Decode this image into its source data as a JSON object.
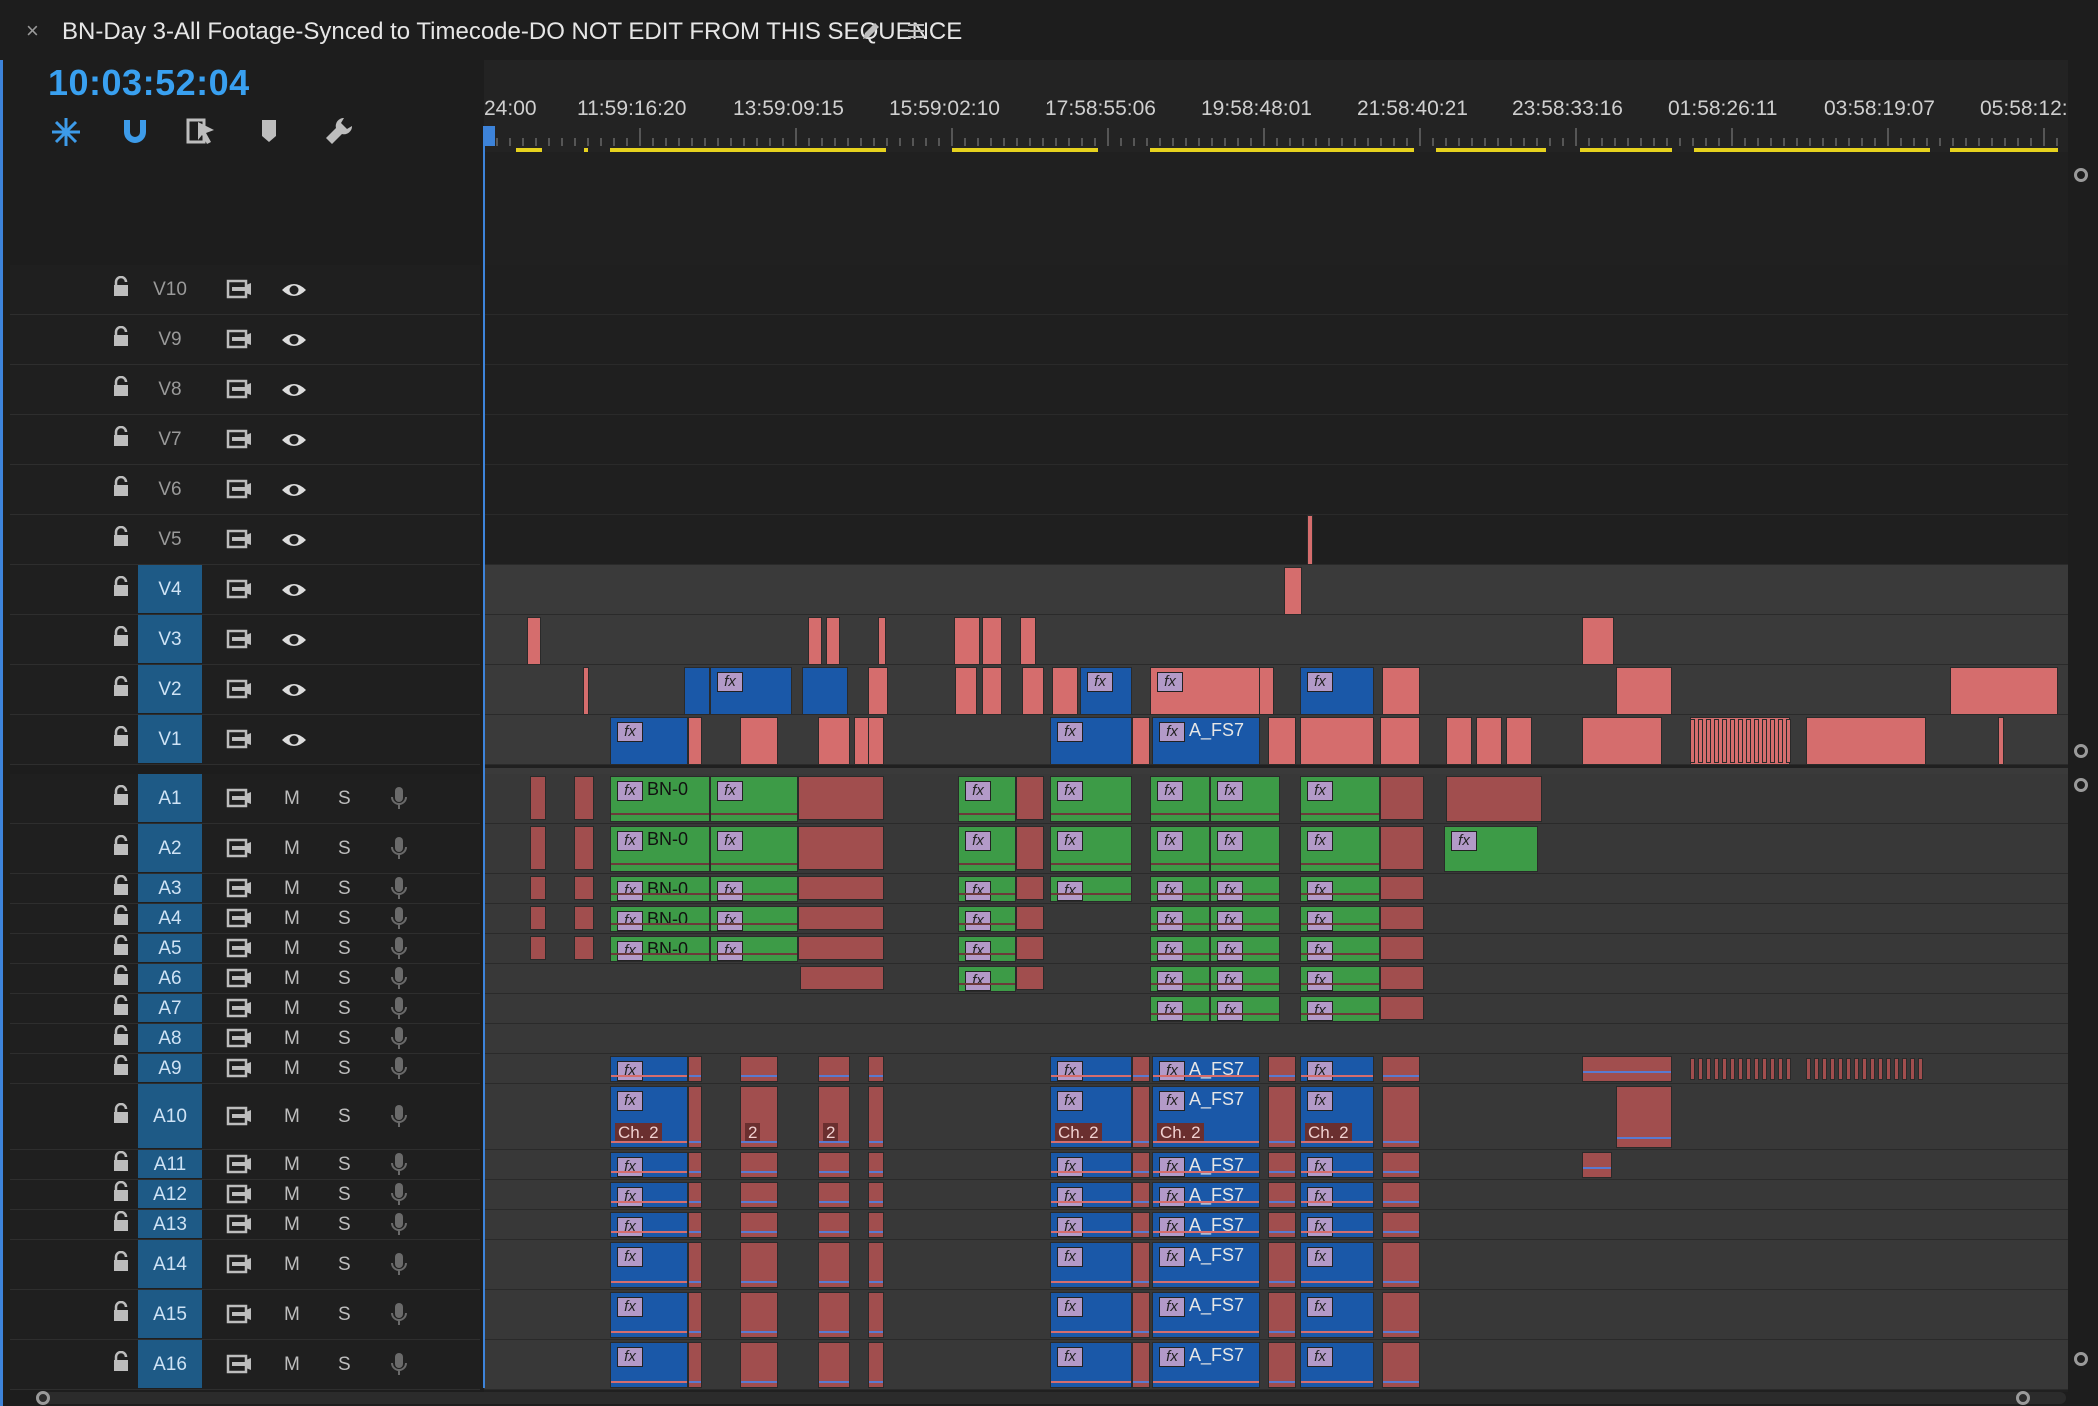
{
  "panel": {
    "close_glyph": "×",
    "title": "BN-Day 3-All Footage-Synced to Timecode-DO NOT EDIT FROM THIS SEQUENCE",
    "timecode": "10:03:52:04"
  },
  "tools": [
    "snap-in-timeline-icon",
    "linked-selection-icon",
    "add-marker-icon",
    "timeline-display-settings-icon"
  ],
  "ruler": {
    "labels": [
      "24:00",
      "11:59:16:20",
      "13:59:09:15",
      "15:59:02:10",
      "17:58:55:06",
      "19:58:48:01",
      "21:58:40:21",
      "23:58:33:16",
      "01:58:26:11",
      "03:58:19:07",
      "05:58:12:"
    ]
  },
  "video_tracks": [
    {
      "name": "V10",
      "active": false
    },
    {
      "name": "V9",
      "active": false
    },
    {
      "name": "V8",
      "active": false
    },
    {
      "name": "V7",
      "active": false
    },
    {
      "name": "V6",
      "active": false
    },
    {
      "name": "V5",
      "active": false
    },
    {
      "name": "V4",
      "active": true
    },
    {
      "name": "V3",
      "active": true
    },
    {
      "name": "V2",
      "active": true
    },
    {
      "name": "V1",
      "active": true
    }
  ],
  "audio_tracks": [
    {
      "name": "A1",
      "m": "M",
      "s": "S"
    },
    {
      "name": "A2",
      "m": "M",
      "s": "S"
    },
    {
      "name": "A3",
      "m": "M",
      "s": "S"
    },
    {
      "name": "A4",
      "m": "M",
      "s": "S"
    },
    {
      "name": "A5",
      "m": "M",
      "s": "S"
    },
    {
      "name": "A6",
      "m": "M",
      "s": "S"
    },
    {
      "name": "A7",
      "m": "M",
      "s": "S"
    },
    {
      "name": "A8",
      "m": "M",
      "s": "S"
    },
    {
      "name": "A9",
      "m": "M",
      "s": "S"
    },
    {
      "name": "A10",
      "m": "M",
      "s": "S"
    },
    {
      "name": "A11",
      "m": "M",
      "s": "S"
    },
    {
      "name": "A12",
      "m": "M",
      "s": "S"
    },
    {
      "name": "A13",
      "m": "M",
      "s": "S"
    },
    {
      "name": "A14",
      "m": "M",
      "s": "S"
    },
    {
      "name": "A15",
      "m": "M",
      "s": "S"
    },
    {
      "name": "A16",
      "m": "M",
      "s": "S"
    }
  ],
  "clip_labels": {
    "fx": "fx",
    "bn": "BN-0",
    "afs": "A_FS7",
    "ch2": "Ch. 2",
    "two": "2"
  },
  "colors": {
    "accent": "#3d83d9",
    "timecode": "#39a0f0",
    "video_clip": "#d56d6d",
    "nested_clip": "#1a58a8",
    "audio_green": "#3d9b47",
    "audio_red": "#a14e4e",
    "render_bar": "#e6d21e"
  }
}
